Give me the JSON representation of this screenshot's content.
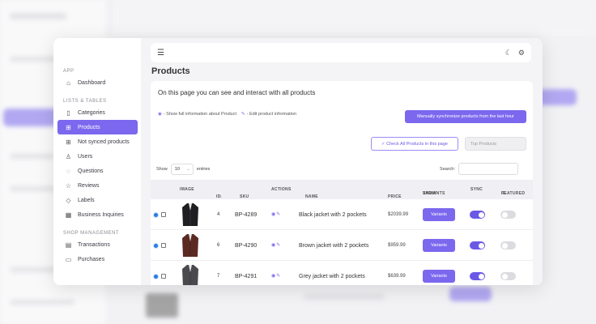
{
  "sidebar": {
    "sections": [
      {
        "title": "APP",
        "items": [
          {
            "label": "Dashboard",
            "icon": "home-icon"
          }
        ]
      },
      {
        "title": "LISTS & TABLES",
        "items": [
          {
            "label": "Categories",
            "icon": "book-icon"
          },
          {
            "label": "Products",
            "icon": "grid-icon",
            "active": true
          },
          {
            "label": "Not synced products",
            "icon": "grid-icon"
          },
          {
            "label": "Users",
            "icon": "user-icon"
          },
          {
            "label": "Questions",
            "icon": "question-icon"
          },
          {
            "label": "Reviews",
            "icon": "star-icon"
          },
          {
            "label": "Labels",
            "icon": "tag-icon"
          },
          {
            "label": "Business Inquiries",
            "icon": "building-icon"
          }
        ]
      },
      {
        "title": "SHOP MANAGEMENT",
        "items": [
          {
            "label": "Transactions",
            "icon": "document-icon"
          },
          {
            "label": "Purchases",
            "icon": "cart-icon"
          }
        ]
      }
    ]
  },
  "page": {
    "title": "Products",
    "intro": "On this page you can see and interact with all products",
    "legend_view": "- Show full information about Product",
    "legend_edit": "- Edit product information",
    "sync_button": "Manually synchronize products from the last hour",
    "check_all_button": "✓ Check All Products in this page",
    "top_products_placeholder": "Top Products",
    "show_label": "Show",
    "entries_value": "10",
    "entries_label": "entries",
    "search_label": "Search:"
  },
  "table": {
    "headers": {
      "image": "IMAGE",
      "id": "ID",
      "sku": "SKU",
      "actions": "ACTIONS",
      "name": "NAME",
      "price": "PRICE",
      "show_variants": [
        "SHOW",
        "VARIANTS"
      ],
      "sync": "SYNC",
      "is_featured": [
        "IS",
        "FEATURED"
      ]
    },
    "rows": [
      {
        "id": "4",
        "sku": "BP-4289",
        "name": "Black jacket with 2 pockets",
        "price": "$2039.99",
        "variants": "Variants",
        "jacket_color": "#1f1f22",
        "sync": true,
        "featured": false
      },
      {
        "id": "6",
        "sku": "BP-4290",
        "name": "Brown jacket with 2 pockets",
        "price": "$959.99",
        "variants": "Variants",
        "jacket_color": "#5a2a22",
        "sync": true,
        "featured": false
      },
      {
        "id": "7",
        "sku": "BP-4291",
        "name": "Grey jacket with 2 pockets",
        "price": "$639.99",
        "variants": "Variants",
        "jacket_color": "#4a4a4e",
        "sync": true,
        "featured": false
      }
    ]
  },
  "colors": {
    "accent": "#7b68ee",
    "radio": "#2a7de1"
  }
}
